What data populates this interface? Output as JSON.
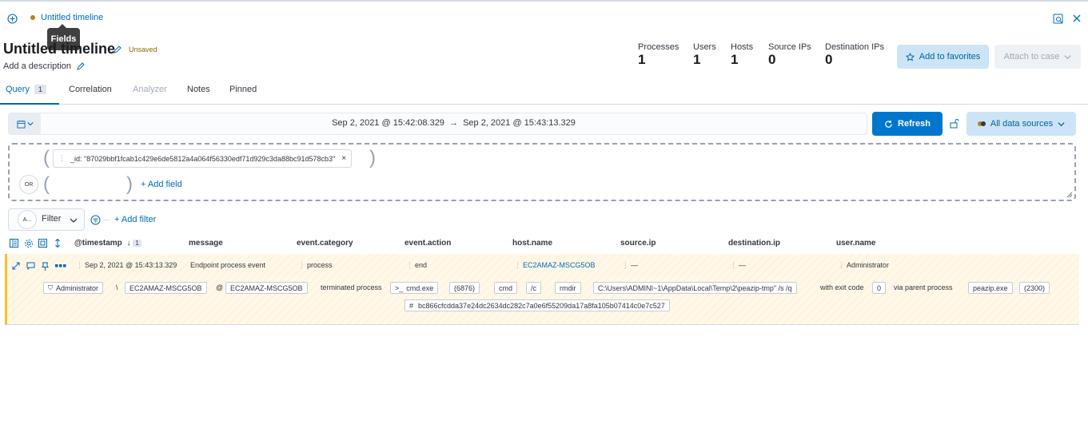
{
  "header": {
    "breadcrumb_title": "Untitled timeline",
    "tooltip": "Fields",
    "title": "Untitled timeline",
    "status": "Unsaved",
    "description_placeholder": "Add a description"
  },
  "stats": [
    {
      "label": "Processes",
      "value": "1"
    },
    {
      "label": "Users",
      "value": "1"
    },
    {
      "label": "Hosts",
      "value": "1"
    },
    {
      "label": "Source IPs",
      "value": "0"
    },
    {
      "label": "Destination IPs",
      "value": "0"
    }
  ],
  "actions": {
    "add_to_favorites": "Add to favorites",
    "attach_to_case": "Attach to case"
  },
  "tabs": {
    "query": "Query",
    "query_count": "1",
    "correlation": "Correlation",
    "analyzer": "Analyzer",
    "notes": "Notes",
    "pinned": "Pinned"
  },
  "date_range": {
    "start": "Sep 2, 2021 @ 15:42:08.329",
    "arrow": "→",
    "end": "Sep 2, 2021 @ 15:43:13.329"
  },
  "refresh_label": "Refresh",
  "data_sources_label": "All data sources",
  "dropzone": {
    "query_pill": "_id: \"87029bbf1fcab1c429e6de5812a4a064f56330edf71d929c3da88bc91d578cb3\"",
    "or_label": "OR",
    "add_field": "+ Add field"
  },
  "filter": {
    "avatar": "A...",
    "label": "Filter",
    "add_filter": "+ Add filter"
  },
  "columns": {
    "timestamp": "@timestamp",
    "timestamp_sort_index": "1",
    "message": "message",
    "event_category": "event.category",
    "event_action": "event.action",
    "host_name": "host.name",
    "source_ip": "source.ip",
    "destination_ip": "destination.ip",
    "user_name": "user.name"
  },
  "row": {
    "timestamp": "Sep 2, 2021 @ 15:43:13.329",
    "message": "Endpoint process event",
    "event_category": "process",
    "event_action": "end",
    "host_name": "EC2AMAZ-MSCG5OB",
    "source_ip": "—",
    "destination_ip": "—",
    "user_name": "Administrator",
    "details": {
      "user": "Administrator",
      "sep1": "\\",
      "domain": "EC2AMAZ-MSCG5OB",
      "at": "@",
      "host": "EC2AMAZ-MSCG5OB",
      "terminated": "terminated process",
      "process": "cmd.exe",
      "pid": "(6876)",
      "arg0": "cmd",
      "arg1": "/c",
      "arg2": "rmdir",
      "arg3": "C:\\Users\\ADMINI~1\\AppData\\Local\\Temp\\2\\peazip-tmp\" /s /q",
      "with_exit_code": "with exit code",
      "exit_code": "0",
      "via_parent": "via parent process",
      "parent": "peazip.exe",
      "parent_pid": "(2300)",
      "hash": "bc866cfcdda37e24dc2634dc282c7a0e6f55209da17a8fa105b07414c0e7c527"
    }
  },
  "colors": {
    "accent": "#006bb8",
    "primary_button": "#0077cc",
    "highlight_border": "#f5c131",
    "unsaved_dot": "#b9801e"
  }
}
